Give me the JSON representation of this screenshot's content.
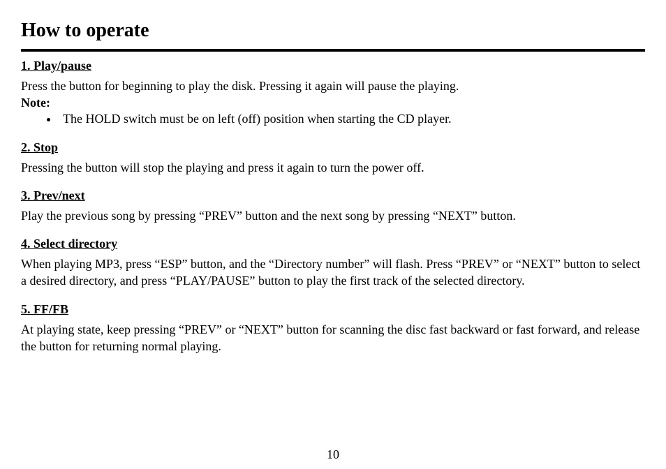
{
  "title": "How to operate",
  "sections": [
    {
      "heading": "1. Play/pause",
      "text": "Press the button for beginning to play the disk. Pressing it again will pause the playing.",
      "note_label": "Note:",
      "bullet": "The HOLD switch must be on left (off) position when starting the CD player."
    },
    {
      "heading": "2. Stop",
      "text": "Pressing the button will stop the playing and press it again to turn the power off."
    },
    {
      "heading": "3. Prev/next",
      "text": "Play the previous song by pressing “PREV” button and the next song by pressing “NEXT” button."
    },
    {
      "heading": "4. Select directory",
      "text": "When playing MP3, press “ESP” button, and the “Directory number” will flash. Press “PREV” or “NEXT” button to select a desired directory, and press “PLAY/PAUSE” button to play the first track of the selected directory."
    },
    {
      "heading": "5. FF/FB",
      "text": "At playing state, keep pressing “PREV” or “NEXT” button for scanning the disc fast backward or fast forward, and release the button for returning normal playing."
    }
  ],
  "page_number": "10"
}
